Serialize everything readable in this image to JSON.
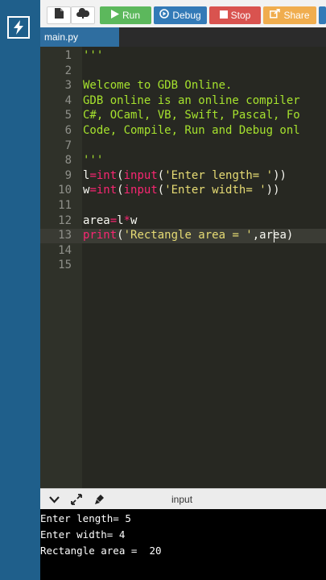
{
  "toolbar": {
    "run_label": "Run",
    "debug_label": "Debug",
    "stop_label": "Stop",
    "share_label": "Share"
  },
  "tabs": [
    {
      "label": "main.py"
    }
  ],
  "editor": {
    "line_numbers": [
      "1",
      "2",
      "3",
      "4",
      "5",
      "6",
      "7",
      "8",
      "9",
      "10",
      "11",
      "12",
      "13",
      "14",
      "15"
    ],
    "lines": {
      "l1": "'''",
      "l3": "Welcome to GDB Online.",
      "l4": "GDB online is an online compiler",
      "l5": "C#, OCaml, VB, Swift, Pascal, Fo",
      "l6": "Code, Compile, Run and Debug onl",
      "l8": "'''",
      "l9_var": "l",
      "l9_eq": "=",
      "l9_int": "int",
      "l9_open": "(",
      "l9_input": "input",
      "l9_open2": "(",
      "l9_str": "'Enter length= '",
      "l9_close": "))",
      "l10_var": "w",
      "l10_eq": "=",
      "l10_int": "int",
      "l10_open": "(",
      "l10_input": "input",
      "l10_open2": "(",
      "l10_str": "'Enter width= '",
      "l10_close": "))",
      "l12_var": "area",
      "l12_eq": "=",
      "l12_a": "l",
      "l12_op": "*",
      "l12_b": "w",
      "l13_print": "print",
      "l13_open": "(",
      "l13_str": "'Rectangle area = '",
      "l13_rest": ",area)"
    },
    "active_line": 13
  },
  "io_panel": {
    "title": "input",
    "output_lines": [
      "Enter length= 5",
      "Enter width= 4",
      "Rectangle area =  20"
    ]
  },
  "colors": {
    "sidebar": "#1f5f8b",
    "run": "#5cb85c",
    "debug": "#337ab7",
    "stop": "#d9534f",
    "share": "#f0ad4e",
    "editor_bg": "#272822"
  },
  "icons": [
    "bolt-icon",
    "new-file-icon",
    "upload-cloud-icon",
    "play-icon",
    "debug-icon",
    "stop-icon",
    "share-icon",
    "chevron-down-icon",
    "expand-icon",
    "clear-icon"
  ]
}
